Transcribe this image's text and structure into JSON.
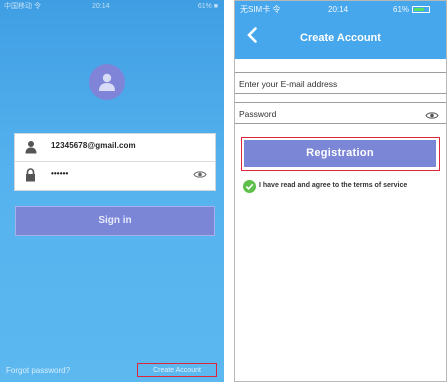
{
  "colors": {
    "left_bg": "#55b2ee",
    "header_blue": "#47a7ec",
    "button_purple": "#7b86d6",
    "highlight_red": "#e0263a",
    "check_green": "#5ec04a"
  },
  "left_screen": {
    "status": {
      "carrier": "中国移动 令",
      "time": "20:14",
      "battery": "61% ■"
    },
    "avatar_icon": "user-avatar-icon",
    "username_value": "12345678@gmail.com",
    "password_value": "••••••",
    "signin_label": "Sign in",
    "forgot_label": "Forgot password?",
    "create_label": "Create Account"
  },
  "right_screen": {
    "status": {
      "carrier": "无SIM卡 令",
      "time": "20:14",
      "battery": "61%"
    },
    "title": "Create Account",
    "email_placeholder": "Enter your E-mail address",
    "password_placeholder": "Password",
    "register_label": "Registration",
    "agree_text": "I have read and agree to the terms of service"
  }
}
